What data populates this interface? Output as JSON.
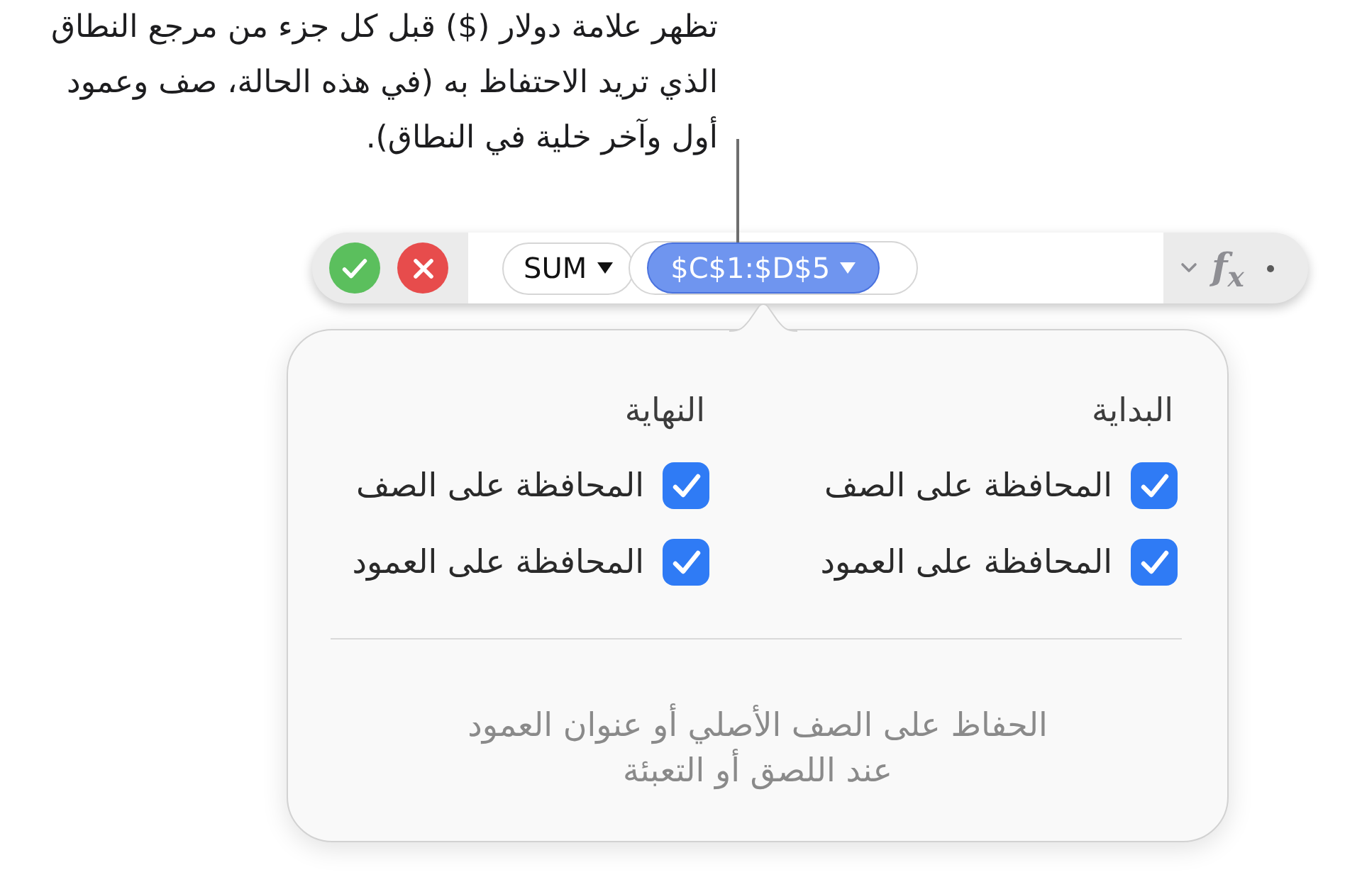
{
  "callout": {
    "lines": [
      "تظهر علامة دولار ($) قبل كل جزء من مرجع النطاق",
      "الذي تريد الاحتفاظ به (في هذه الحالة، صف وعمود",
      "أول وآخر خلية في النطاق)."
    ]
  },
  "formula_bar": {
    "function": {
      "label": "SUM",
      "selected": false,
      "arguments": [
        {
          "kind": "range",
          "label": "$C$1:$D$5",
          "selected": true
        }
      ]
    },
    "function_label": "f$_{x}$"
  },
  "popover": {
    "columns": [
      {
        "heading": "البداية",
        "options": [
          {
            "label": "المحافظة على الصف",
            "checked": true
          },
          {
            "label": "المحافظة على العمود",
            "checked": true
          }
        ]
      },
      {
        "heading": "النهاية",
        "options": [
          {
            "label": "المحافظة على الصف",
            "checked": true
          },
          {
            "label": "المحافظة على العمود",
            "checked": true
          }
        ]
      }
    ],
    "footer_lines": [
      "الحفاظ على الصف الأصلي أو عنوان العمود",
      "عند اللصق أو التعبئة"
    ]
  }
}
